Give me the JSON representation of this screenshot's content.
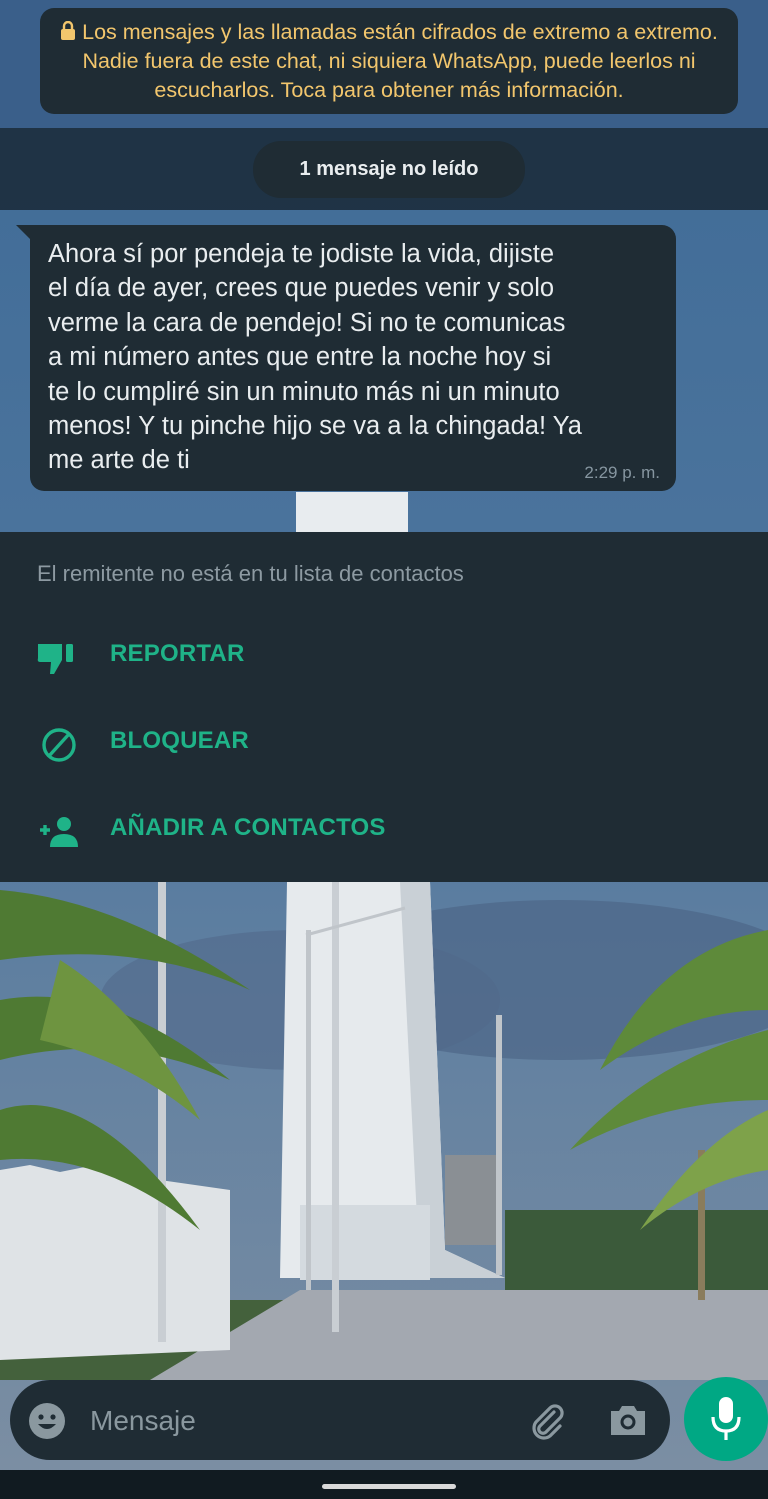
{
  "encryption_notice": "Los mensajes y las llamadas están cifrados de extremo a extremo. Nadie fuera de este chat, ni siquiera WhatsApp, puede leerlos ni escucharlos. Toca para obtener más información.",
  "unread_divider": "1 mensaje no leído",
  "message": {
    "lines": [
      "Ahora sí por pendeja te jodiste la vida, dijiste",
      "el día de ayer, crees que puedes venir y solo",
      "verme la cara de pendejo! Si no te comunicas",
      "a mi número antes que entre la noche hoy si",
      "te lo cumpliré sin un minuto más ni un minuto",
      "menos! Y tu pinche hijo se va a la chingada! Ya",
      "me arte de ti"
    ],
    "time": "2:29 p. m."
  },
  "unknown_sender": {
    "notice": "El remitente no está en tu lista de contactos",
    "actions": [
      {
        "label": "REPORTAR",
        "icon": "thumbs-down-report-icon"
      },
      {
        "label": "BLOQUEAR",
        "icon": "block-icon"
      },
      {
        "label": "AÑADIR A CONTACTOS",
        "icon": "add-contact-icon"
      }
    ]
  },
  "composer": {
    "placeholder": "Mensaje",
    "icons": [
      "emoji-icon",
      "attach-clip-icon",
      "camera-icon",
      "mic-icon"
    ]
  },
  "colors": {
    "accent": "#00a884",
    "action_text": "#1fb388",
    "bubble": "#1f2c34",
    "notice_text": "#f2c66d"
  }
}
